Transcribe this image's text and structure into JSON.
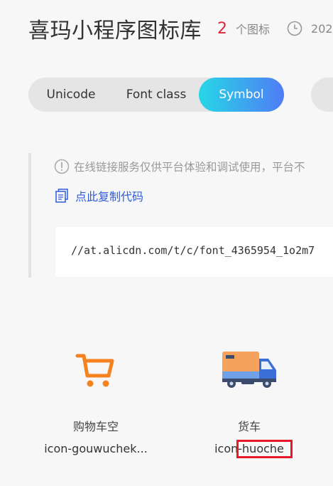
{
  "header": {
    "title": "喜玛小程序图标库",
    "count": "2",
    "count_label": "个图标",
    "date": "202"
  },
  "tabs": [
    {
      "label": "Unicode",
      "active": false
    },
    {
      "label": "Font class",
      "active": false
    },
    {
      "label": "Symbol",
      "active": true
    }
  ],
  "notice": {
    "tip": "在线链接服务仅供平台体验和调试使用，平台不",
    "copy_label": "点此复制代码",
    "code": "//at.alicdn.com/t/c/font_4365954_1o2m7"
  },
  "icons": [
    {
      "name": "购物车空",
      "code": "icon-gouwuchek...",
      "icon": "shopping-cart-icon",
      "color": "#f5811f"
    },
    {
      "name": "货车",
      "code": "icon-huoche",
      "icon": "truck-icon",
      "color": "#f4a25c"
    }
  ],
  "colors": {
    "accent_start": "#27d7e6",
    "accent_end": "#4f7cf5",
    "count_red": "#e0243a",
    "link_blue": "#2f5bdb",
    "highlight_red": "#e8182b"
  }
}
